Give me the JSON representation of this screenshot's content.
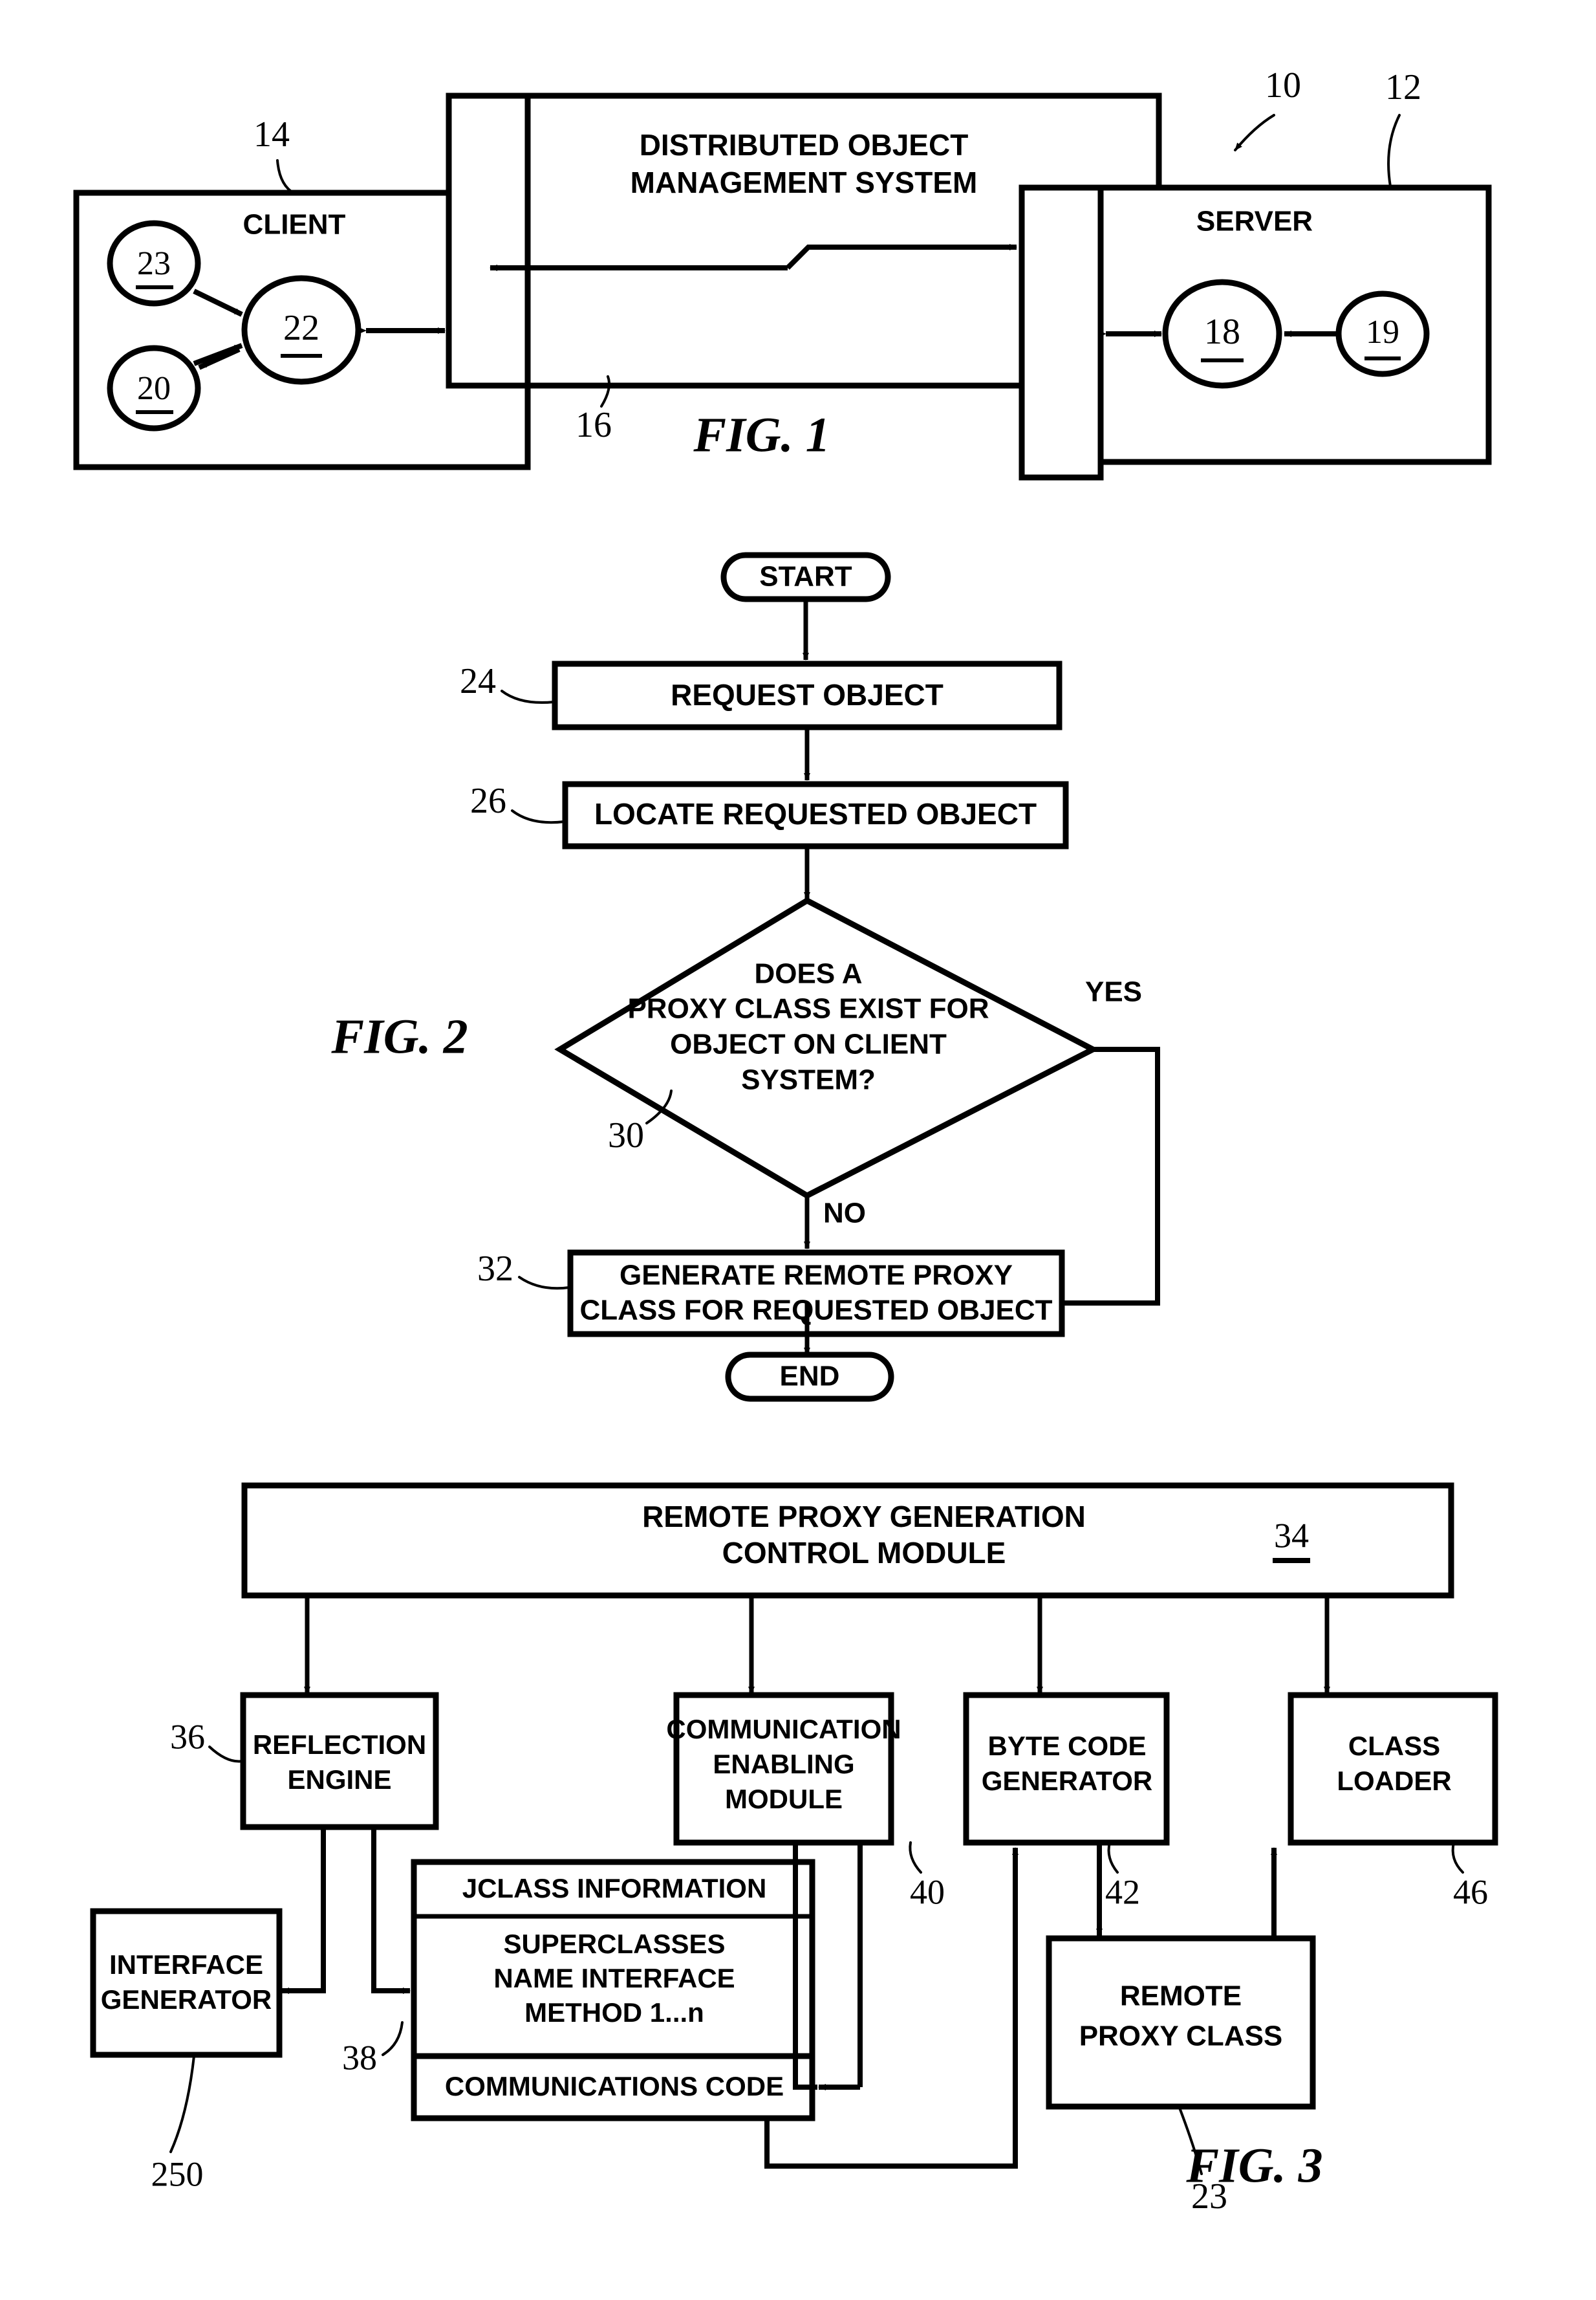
{
  "document": {
    "type": "patent-drawing-sheet",
    "figures": [
      "FIG. 1",
      "FIG. 2",
      "FIG. 3"
    ]
  },
  "figure1": {
    "caption": "FIG. 1",
    "system_ref": "10",
    "client": {
      "title": "CLIENT",
      "ref": "14",
      "nodes": [
        {
          "ref": "23"
        },
        {
          "ref": "22"
        },
        {
          "ref": "20"
        }
      ]
    },
    "middleware": {
      "title_line1": "DISTRIBUTED OBJECT",
      "title_line2": "MANAGEMENT SYSTEM",
      "ref": "16"
    },
    "server": {
      "title": "SERVER",
      "ref": "12",
      "nodes": [
        {
          "ref": "18"
        },
        {
          "ref": "19"
        }
      ]
    }
  },
  "figure2": {
    "caption": "FIG. 2",
    "start_label": "START",
    "end_label": "END",
    "steps": [
      {
        "ref": "24",
        "label": "REQUEST OBJECT"
      },
      {
        "ref": "26",
        "label": "LOCATE REQUESTED OBJECT"
      }
    ],
    "decision": {
      "ref": "30",
      "line1": "DOES A",
      "line2": "PROXY CLASS EXIST FOR",
      "line3": "OBJECT ON CLIENT",
      "line4": "SYSTEM?",
      "yes_label": "YES",
      "no_label": "NO"
    },
    "generate": {
      "ref": "32",
      "line1": "GENERATE REMOTE PROXY",
      "line2": "CLASS FOR REQUESTED OBJECT"
    }
  },
  "figure3": {
    "caption": "FIG. 3",
    "control_module": {
      "line1": "REMOTE PROXY GENERATION",
      "line2": "CONTROL MODULE",
      "ref": "34"
    },
    "modules": [
      {
        "ref": "36",
        "lines": [
          "REFLECTION",
          "ENGINE"
        ]
      },
      {
        "ref": "40",
        "lines": [
          "COMMUNICATION",
          "ENABLING",
          "MODULE"
        ]
      },
      {
        "ref": "42",
        "lines": [
          "BYTE CODE",
          "GENERATOR"
        ]
      },
      {
        "ref": "46",
        "lines": [
          "CLASS",
          "LOADER"
        ]
      }
    ],
    "interface_generator": {
      "ref": "250",
      "lines": [
        "INTERFACE",
        "GENERATOR"
      ]
    },
    "jclass": {
      "ref": "38",
      "header": "JCLASS INFORMATION",
      "body": [
        "SUPERCLASSES",
        "NAME INTERFACE",
        "METHOD 1...n"
      ],
      "footer": "COMMUNICATIONS CODE"
    },
    "remote_proxy_class": {
      "ref": "23",
      "lines": [
        "REMOTE",
        "PROXY CLASS"
      ]
    }
  }
}
